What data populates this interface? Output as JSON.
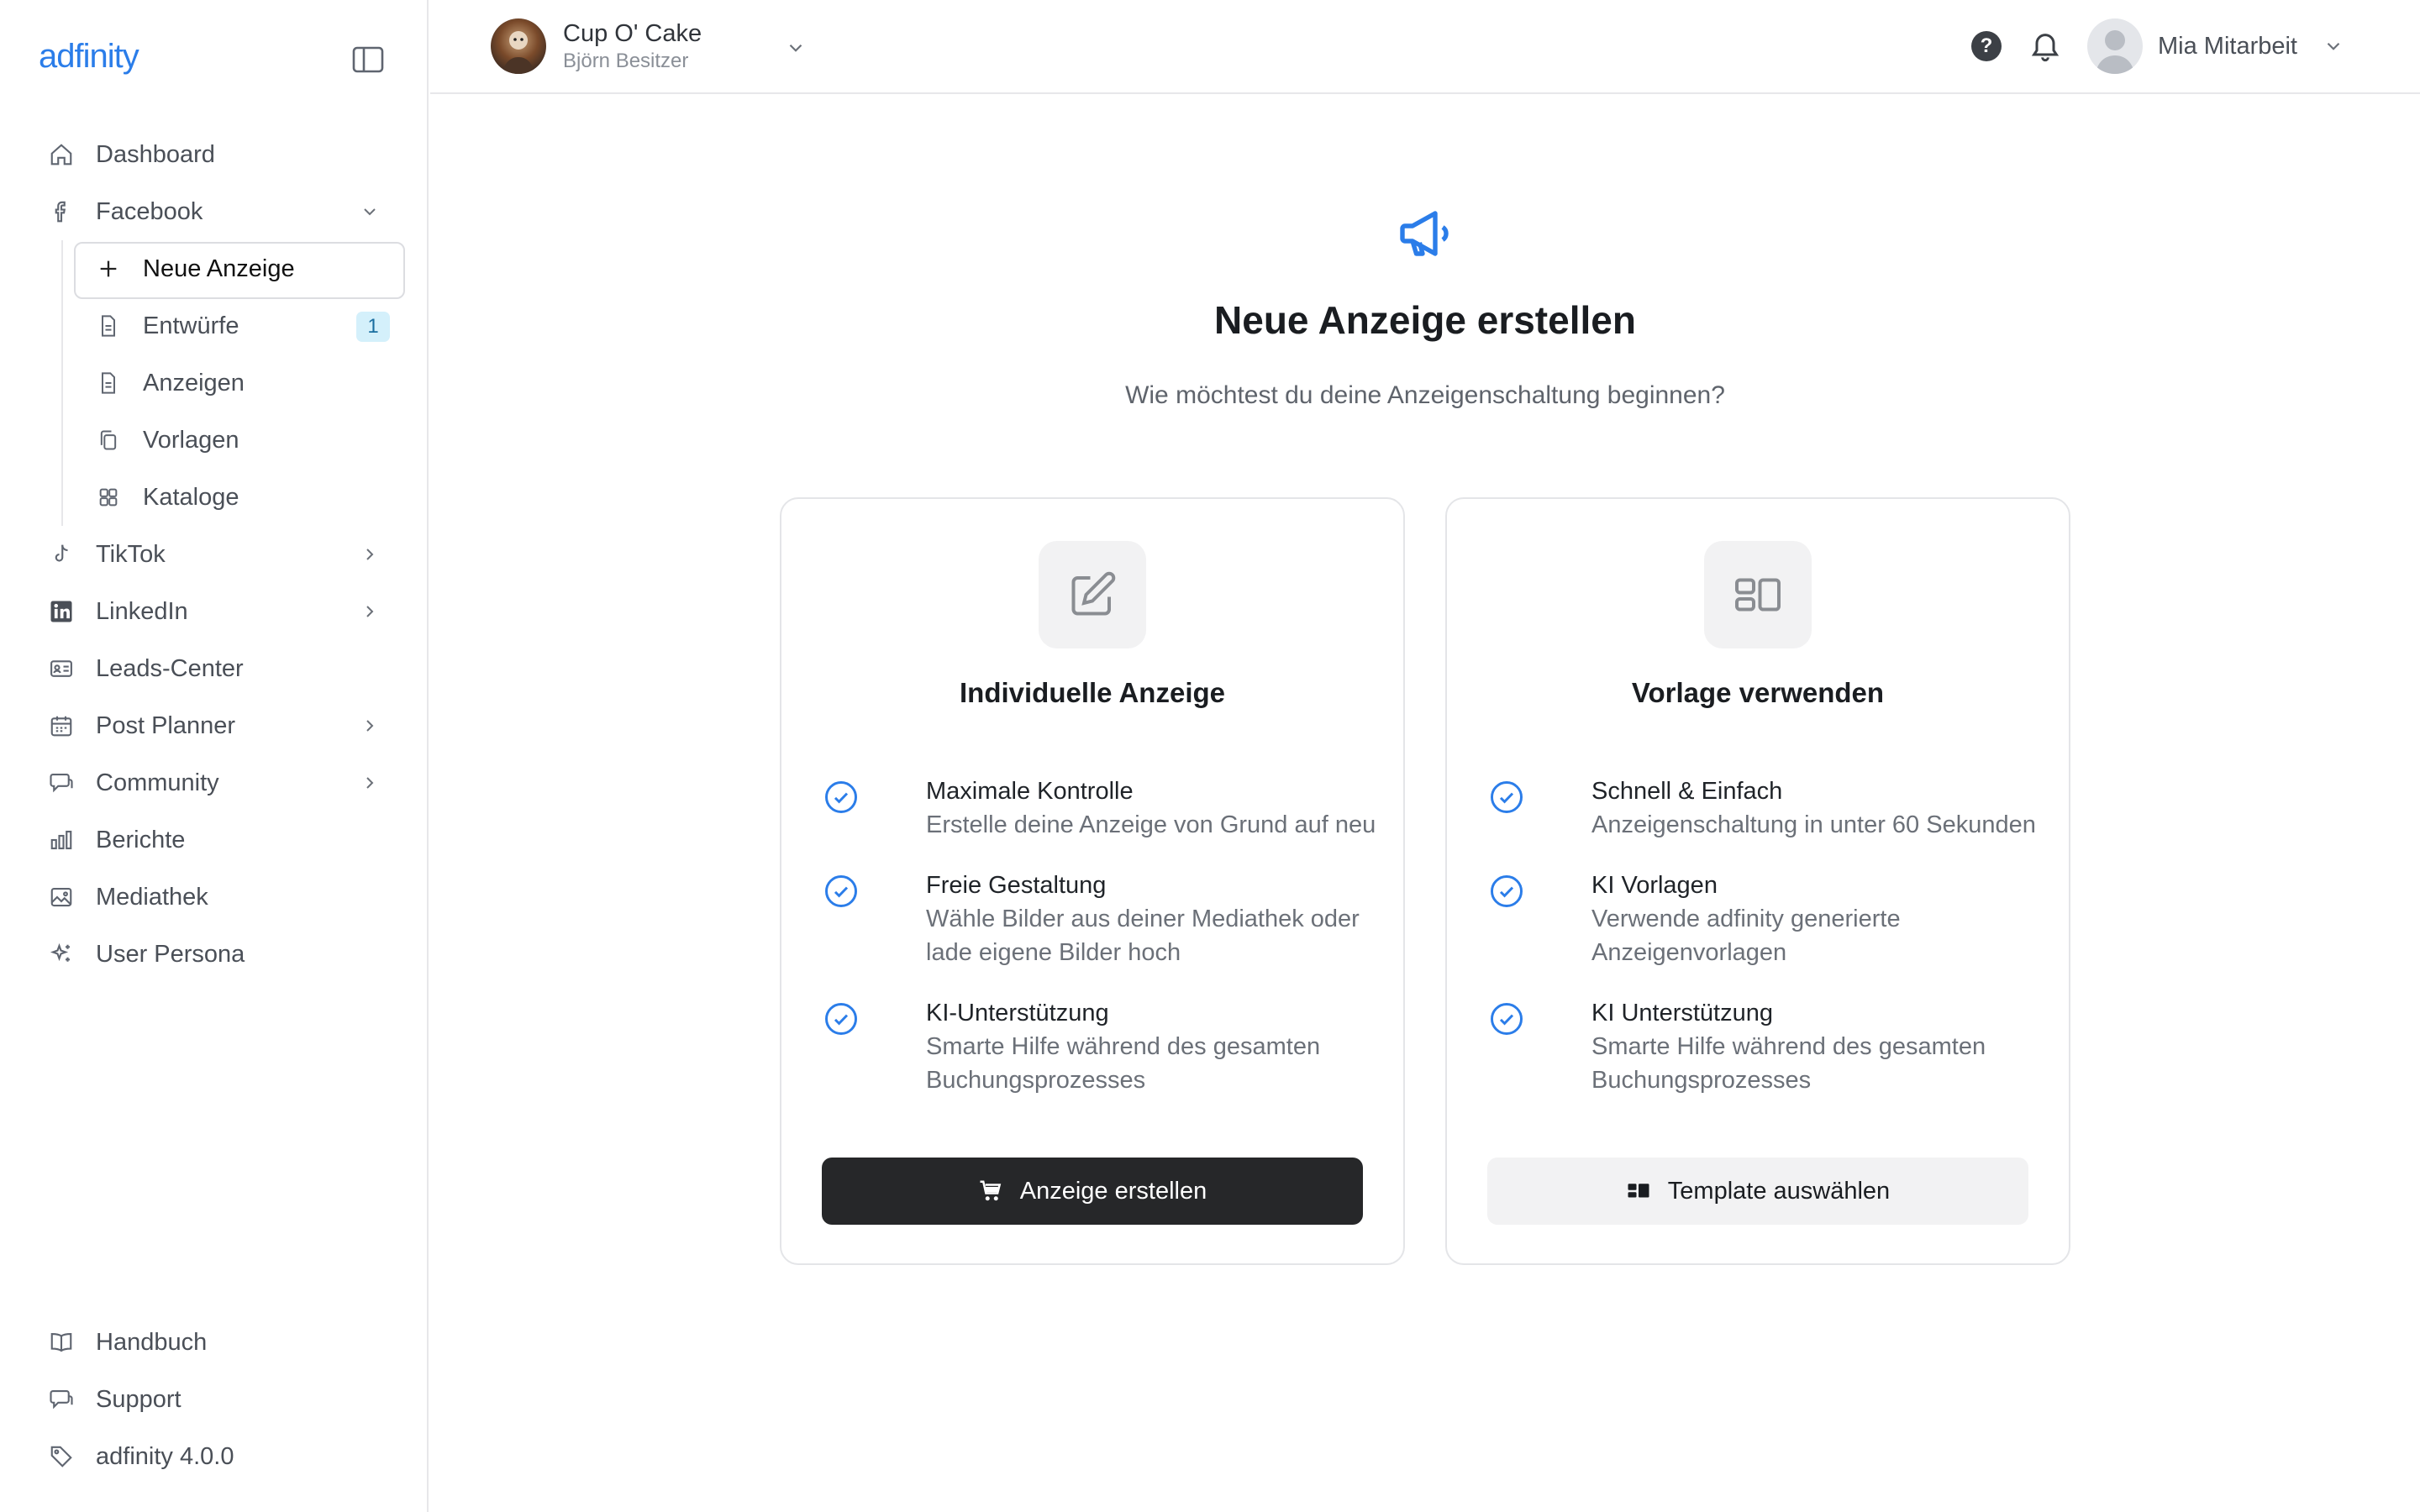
{
  "brand": {
    "logo_text": "adfinity",
    "accent": "#2b7de9"
  },
  "sidebar": {
    "items": [
      {
        "label": "Dashboard",
        "icon": "home-icon"
      },
      {
        "label": "Facebook",
        "icon": "facebook-icon",
        "expanded": true
      },
      {
        "label": "TikTok",
        "icon": "tiktok-icon"
      },
      {
        "label": "LinkedIn",
        "icon": "linkedin-icon"
      },
      {
        "label": "Leads-Center",
        "icon": "id-card-icon"
      },
      {
        "label": "Post Planner",
        "icon": "calendar-icon"
      },
      {
        "label": "Community",
        "icon": "chat-icon"
      },
      {
        "label": "Berichte",
        "icon": "bar-chart-icon"
      },
      {
        "label": "Mediathek",
        "icon": "image-icon"
      },
      {
        "label": "User Persona",
        "icon": "sparkles-icon"
      }
    ],
    "facebook_sub": [
      {
        "label": "Neue Anzeige",
        "icon": "plus-icon",
        "active": true
      },
      {
        "label": "Entwürfe",
        "icon": "document-icon",
        "badge": "1"
      },
      {
        "label": "Anzeigen",
        "icon": "document-icon"
      },
      {
        "label": "Vorlagen",
        "icon": "copy-icon"
      },
      {
        "label": "Kataloge",
        "icon": "grid-icon"
      }
    ],
    "bottom": [
      {
        "label": "Handbuch",
        "icon": "book-icon"
      },
      {
        "label": "Support",
        "icon": "chat-icon"
      },
      {
        "label": "adfinity 4.0.0",
        "icon": "tag-icon"
      }
    ]
  },
  "header": {
    "account_name": "Cup O' Cake",
    "account_owner": "Björn Besitzer",
    "user_name": "Mia Mitarbeit",
    "help_glyph": "?"
  },
  "main": {
    "title": "Neue Anzeige erstellen",
    "subtitle": "Wie möchtest du deine Anzeigenschaltung beginnen?",
    "cards": [
      {
        "heading": "Individuelle Anzeige",
        "icon": "edit-icon",
        "features": [
          {
            "title": "Maximale Kontrolle",
            "desc": "Erstelle deine Anzeige von Grund auf neu"
          },
          {
            "title": "Freie Gestaltung",
            "desc": "Wähle Bilder aus deiner Mediathek oder lade eigene Bilder hoch"
          },
          {
            "title": "KI-Unterstützung",
            "desc": "Smarte Hilfe während des gesamten Buchungsprozesses"
          }
        ],
        "button": "Anzeige erstellen",
        "button_icon": "cart-icon"
      },
      {
        "heading": "Vorlage verwenden",
        "icon": "template-icon",
        "features": [
          {
            "title": "Schnell & Einfach",
            "desc": "Anzeigenschaltung in unter 60 Sekunden"
          },
          {
            "title": "KI Vorlagen",
            "desc": "Verwende adfinity generierte Anzeigenvorlagen"
          },
          {
            "title": "KI Unterstützung",
            "desc": "Smarte Hilfe während des gesamten Buchungsprozesses"
          }
        ],
        "button": "Template auswählen",
        "button_icon": "template-icon"
      }
    ]
  }
}
